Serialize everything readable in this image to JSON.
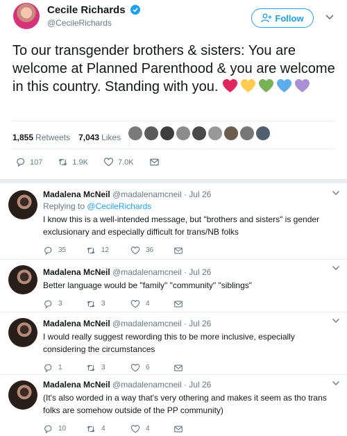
{
  "main_tweet": {
    "author_name": "Cecile Richards",
    "author_handle": "@CecileRichards",
    "follow_label": "Follow",
    "text": "To our transgender brothers & sisters: You are welcome at Planned Parenthood & you are welcome in this country. Standing with you.",
    "hearts": [
      "#e0245e",
      "#ffcc4d",
      "#77b255",
      "#5dadec",
      "#aa8ed6"
    ],
    "retweets_count": "1,855",
    "retweets_label": "Retweets",
    "likes_count": "7,043",
    "likes_label": "Likes",
    "likers_count": 9,
    "replies": "107",
    "retweets": "1.9K",
    "likes": "7.0K"
  },
  "replies": [
    {
      "name": "Madalena McNeil",
      "handle": "@madalenamcneil",
      "date": "Jul 26",
      "replying_label": "Replying to",
      "replying_to": "@CecileRichards",
      "text": "I know this is a well-intended message, but \"brothers and sisters\" is gender exclusionary and especially difficult for trans/NB folks",
      "reply_count": "35",
      "retweet_count": "12",
      "like_count": "36"
    },
    {
      "name": "Madalena McNeil",
      "handle": "@madalenamcneil",
      "date": "Jul 26",
      "text": "Better language would be \"family\" \"community\" \"siblings\"",
      "reply_count": "3",
      "retweet_count": "3",
      "like_count": "4"
    },
    {
      "name": "Madalena McNeil",
      "handle": "@madalenamcneil",
      "date": "Jul 26",
      "text": "I would really suggest rewording this to be more inclusive, especially considering the circumstances",
      "reply_count": "1",
      "retweet_count": "3",
      "like_count": "6"
    },
    {
      "name": "Madalena McNeil",
      "handle": "@madalenamcneil",
      "date": "Jul 26",
      "text": "(It's also worded in a way that's very othering and makes it seem as tho trans folks are somehow outside of the PP community)",
      "reply_count": "10",
      "retweet_count": "4",
      "like_count": "4"
    }
  ],
  "icons": {
    "reply": "reply-icon",
    "retweet": "retweet-icon",
    "like": "heart-icon",
    "dm": "message-icon",
    "verified": "verified-badge-icon",
    "more": "chevron-down-icon",
    "follow": "add-person-icon"
  },
  "colors": {
    "accent": "#1da1f2",
    "muted": "#657786",
    "text": "#14171a"
  }
}
